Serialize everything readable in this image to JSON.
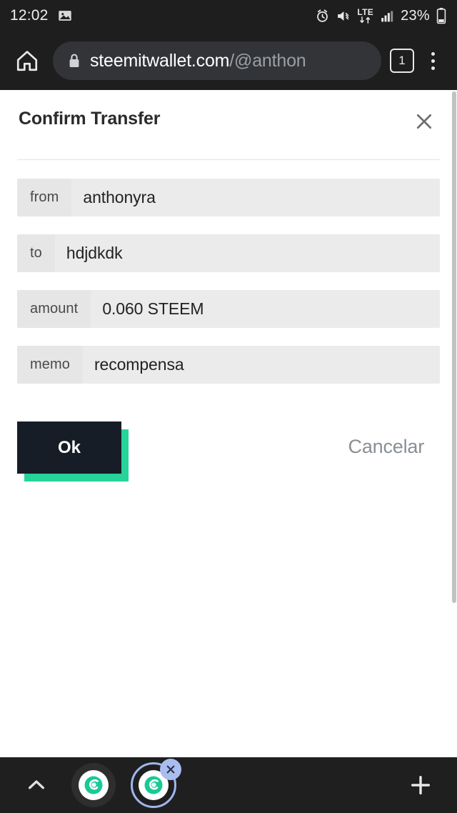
{
  "status_bar": {
    "time": "12:02",
    "battery_percent": "23%",
    "network_label": "LTE",
    "icons": [
      "image-icon",
      "alarm-icon",
      "mute-icon",
      "lte-icon",
      "signal-icon",
      "battery-icon"
    ]
  },
  "browser": {
    "home_icon": "home-icon",
    "lock_icon": "lock-icon",
    "url_domain": "steemitwallet.com",
    "url_path": "/@anthon",
    "tab_count": "1",
    "menu_icon": "overflow-menu-icon"
  },
  "dialog": {
    "title": "Confirm Transfer",
    "close_icon": "close-icon",
    "fields": [
      {
        "label": "from",
        "value": "anthonyra"
      },
      {
        "label": "to",
        "value": "hdjdkdk"
      },
      {
        "label": "amount",
        "value": "0.060 STEEM"
      },
      {
        "label": "memo",
        "value": "recompensa"
      }
    ],
    "confirm_label": "Ok",
    "cancel_label": "Cancelar"
  },
  "bottom_bar": {
    "collapse_icon": "chevron-up-icon",
    "app_icons": [
      "steemit-app-icon",
      "steemit-app-icon-active"
    ],
    "close_badge_icon": "close-badge-icon",
    "add_icon": "plus-icon"
  },
  "colors": {
    "chrome_dark": "#1e1e1e",
    "accent_teal": "#26d49a",
    "button_dark": "#161d26",
    "field_label_bg": "#e6e6e6",
    "field_value_bg": "#ebebeb",
    "cancel_text": "#8a8f94"
  }
}
